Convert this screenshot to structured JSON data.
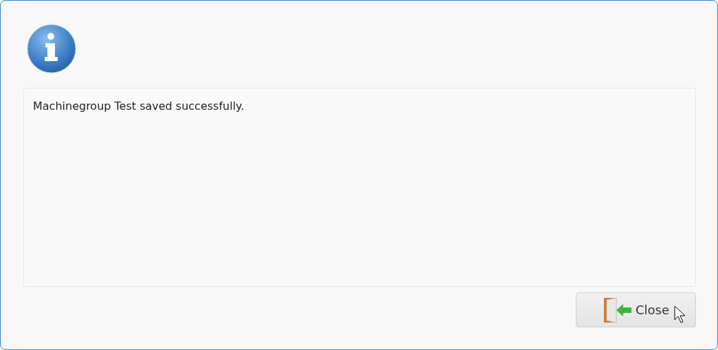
{
  "message": "Machinegroup Test saved successfully.",
  "buttons": [
    {
      "label": "Close"
    }
  ]
}
